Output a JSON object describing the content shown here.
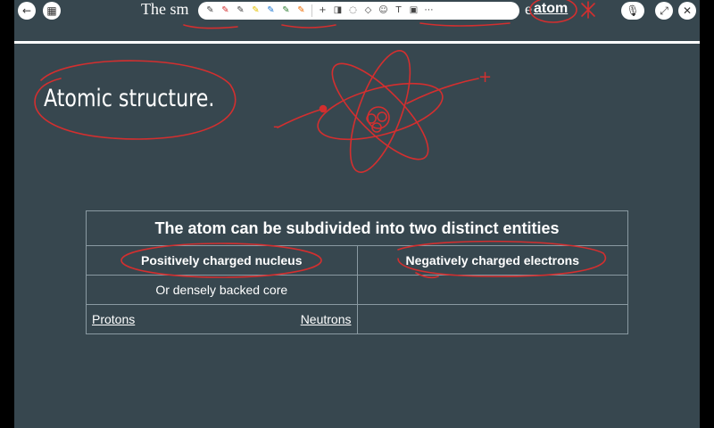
{
  "nav": {
    "back_icon": "arrow-left-icon",
    "pages_icon": "grid-icon",
    "mic_icon": "microphone-icon",
    "close_icon": "close-icon"
  },
  "slide": {
    "title_prefix": "The sm",
    "title_suffix": "e",
    "title_keyword": "atom",
    "heading": "Atomic structure.",
    "table": {
      "header": "The atom can be subdivided into two distinct entities",
      "col1": "Positively charged nucleus",
      "col2": "Negatively charged electrons",
      "row2_col1": "Or densely backed core",
      "row3_left": "Protons",
      "row3_right": "Neutrons"
    },
    "annotations": {
      "plus": "+",
      "minus": "-"
    }
  },
  "colors": {
    "canvas": "#37474f",
    "ink": "#d32f2f",
    "text": "#ffffff"
  }
}
